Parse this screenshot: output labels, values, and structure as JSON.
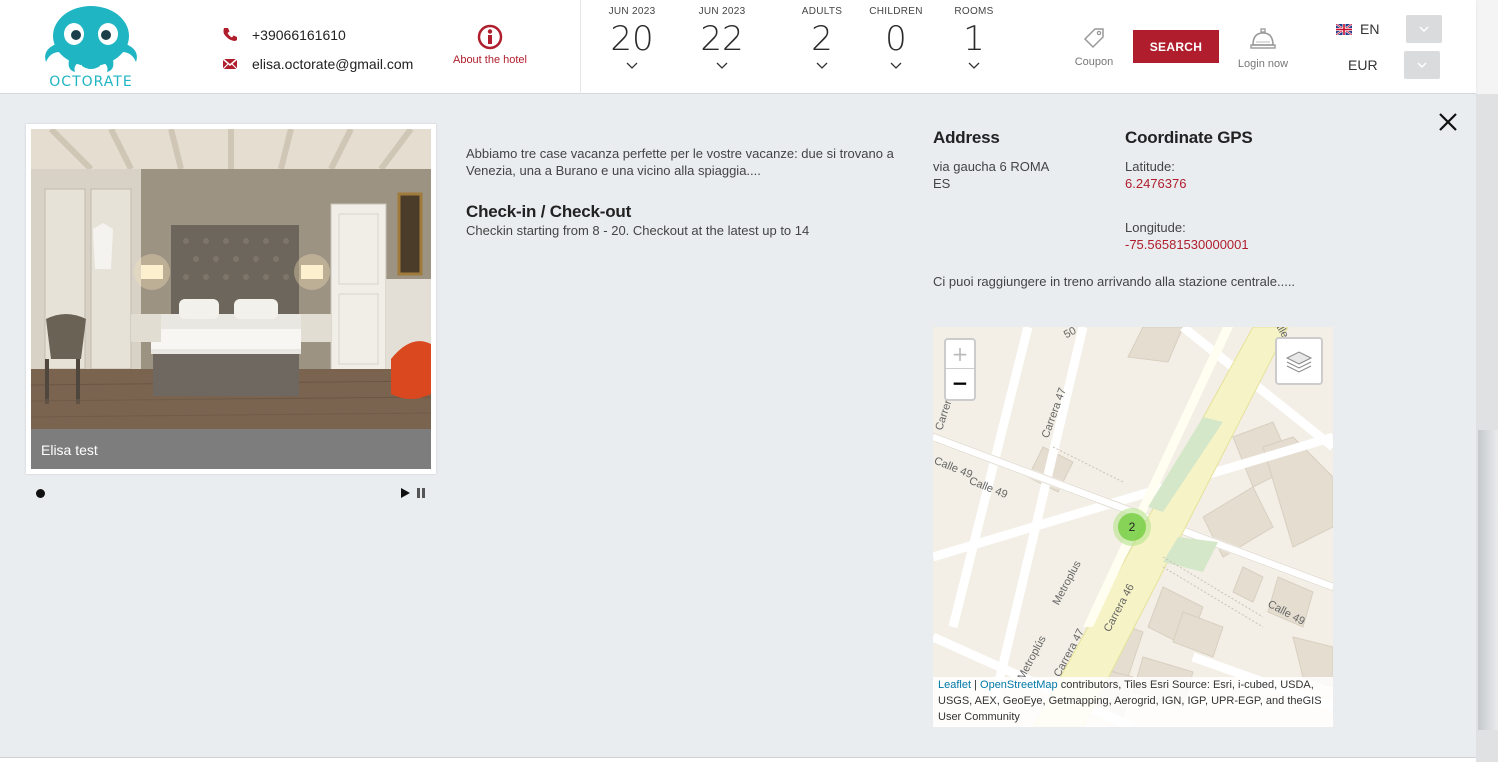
{
  "header": {
    "logo_text": "OCTORATE",
    "phone": "+39066161610",
    "email": "elisa.octorate@gmail.com",
    "about_label": "About the hotel",
    "checkin": {
      "caption": "JUN 2023",
      "value": "20"
    },
    "checkout": {
      "caption": "JUN 2023",
      "value": "22"
    },
    "adults": {
      "caption": "ADULTS",
      "value": "2"
    },
    "children": {
      "caption": "CHILDREN",
      "value": "0"
    },
    "rooms": {
      "caption": "ROOMS",
      "value": "1"
    },
    "coupon_label": "Coupon",
    "search_label": "SEARCH",
    "login_label": "Login now",
    "language": "EN",
    "currency": "EUR"
  },
  "colors": {
    "accent": "#b01e2d",
    "logo": "#1fb5c3",
    "modal_bg": "#e9edf0",
    "cluster": "#6ecc39"
  },
  "gallery": {
    "caption": "Elisa test"
  },
  "details": {
    "description": "Abbiamo tre case vacanza perfette per le vostre vacanze: due si trovano a Venezia, una a Burano e una vicino alla spiaggia....",
    "checkin_title": "Check-in / Check-out",
    "checkin_text": "Checkin starting from 8 - 20. Checkout at the latest up to 14"
  },
  "address": {
    "title": "Address",
    "line1": "via gaucha 6 ROMA",
    "line2": "ES",
    "reach": "Ci puoi raggiungere in treno arrivando alla stazione centrale....."
  },
  "gps": {
    "title": "Coordinate GPS",
    "latitude_label": "Latitude:",
    "latitude": "6.2476376",
    "longitude_label": "Longitude:",
    "longitude": "-75.56581530000001"
  },
  "map": {
    "zoom_in": "+",
    "zoom_out": "−",
    "cluster_count": "2",
    "streets": [
      "Carrera 47",
      "Calle 49",
      "Calle 49",
      "Carrera 46",
      "Metroplus",
      "Calle 49",
      "Carrera 4",
      "Carrera 47",
      "50",
      "Metroplús",
      "Calle 49"
    ],
    "attribution_leaflet": "Leaflet",
    "attribution_sep": " | ",
    "attribution_osm": "OpenStreetMap",
    "attribution_rest": " contributors, Tiles Esri Source: Esri, i-cubed, USDA, USGS, AEX, GeoEye, Getmapping, Aerogrid, IGN, IGP, UPR-EGP, and theGIS User Community"
  },
  "icons": [
    "phone-icon",
    "mail-icon",
    "info-icon",
    "chevron-down-icon",
    "tag-icon",
    "bell-icon",
    "uk-flag-icon",
    "close-icon",
    "play-icon",
    "pause-icon",
    "layers-icon"
  ]
}
